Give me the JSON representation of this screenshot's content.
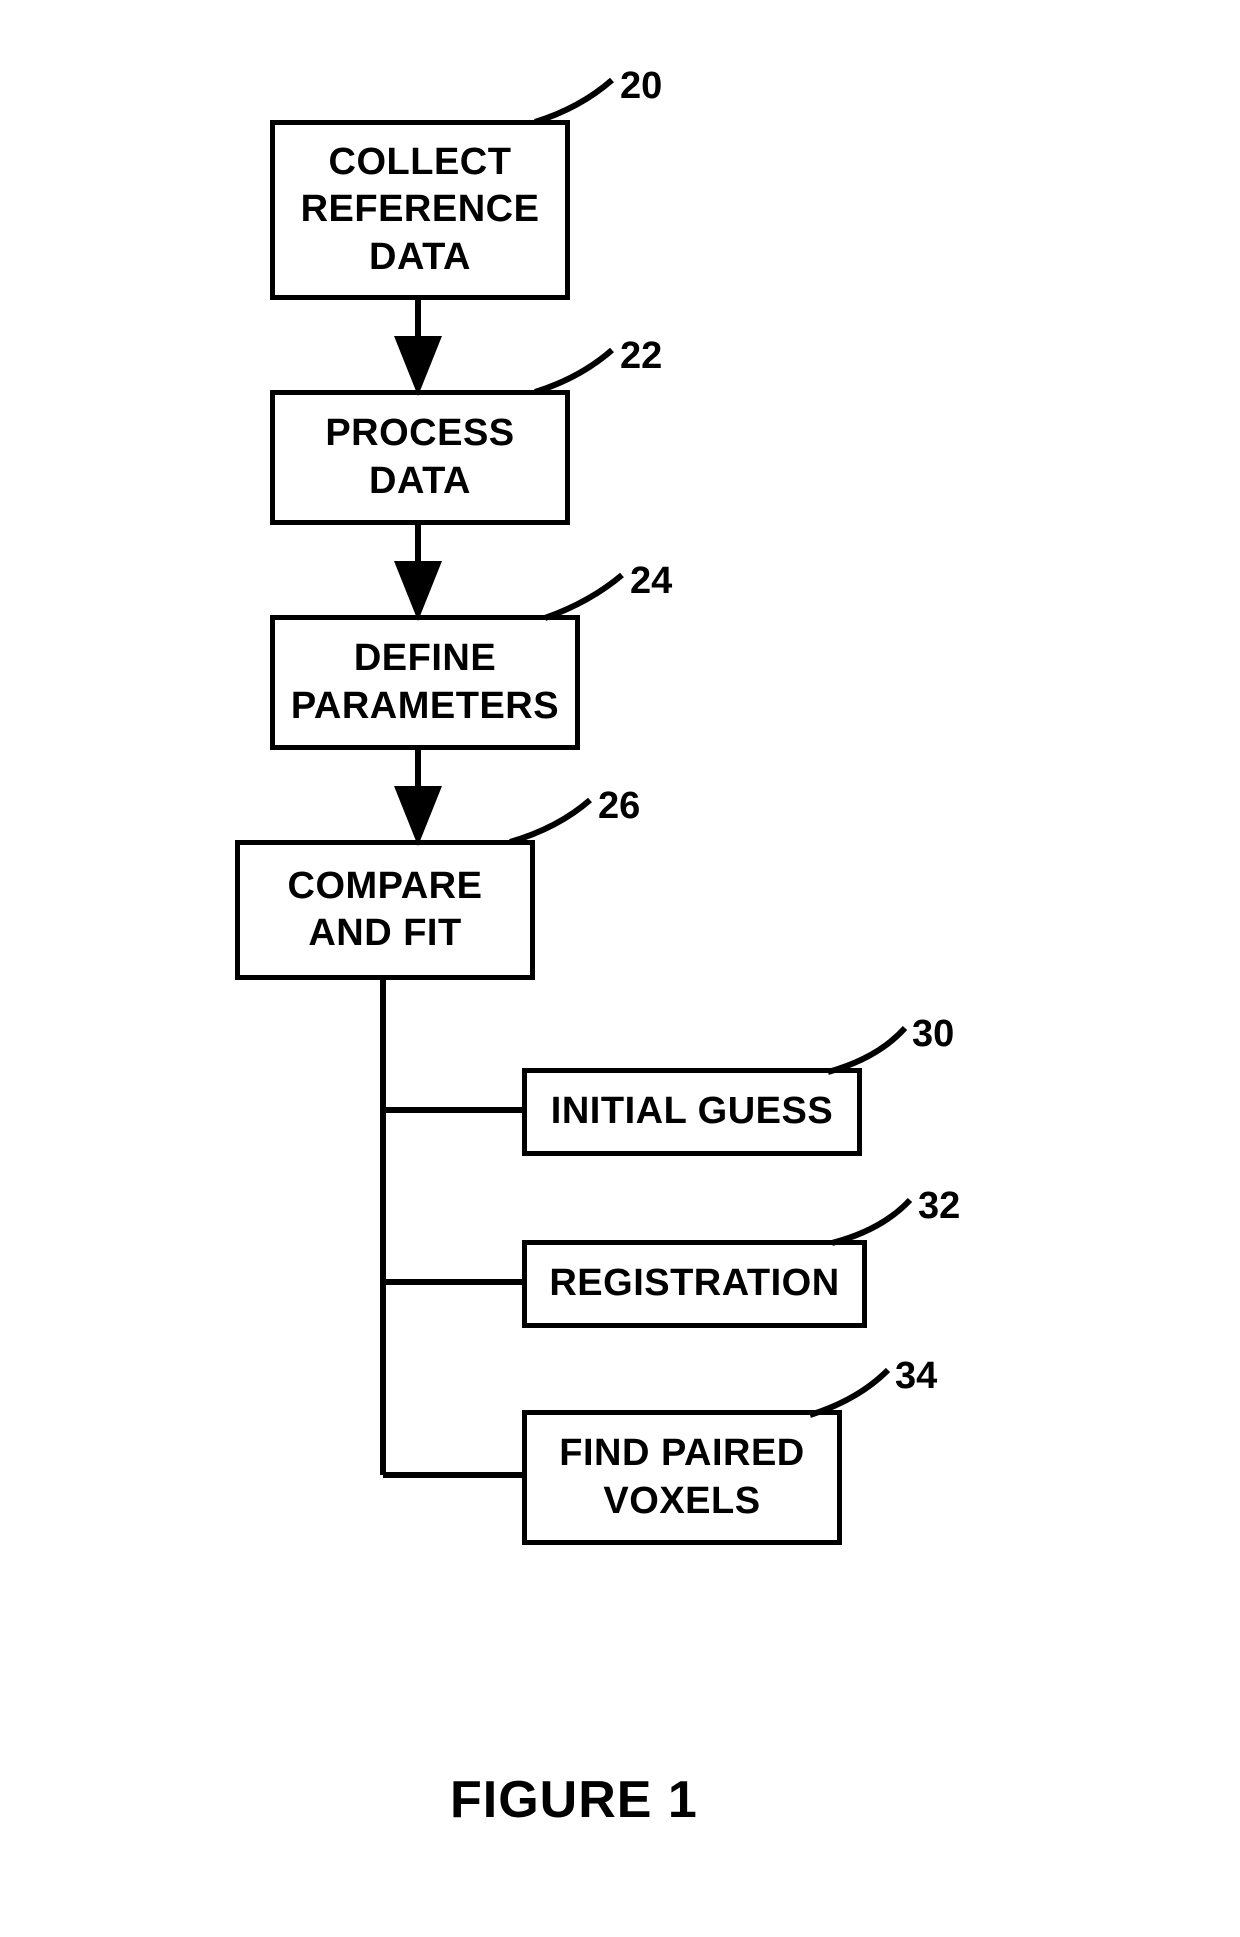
{
  "boxes": {
    "b20": {
      "line1": "COLLECT",
      "line2": "REFERENCE",
      "line3": "DATA"
    },
    "b22": {
      "line1": "PROCESS",
      "line2": "DATA"
    },
    "b24": {
      "line1": "DEFINE",
      "line2": "PARAMETERS"
    },
    "b26": {
      "line1": "COMPARE",
      "line2": "AND FIT"
    },
    "b30": {
      "line1": "INITIAL GUESS"
    },
    "b32": {
      "line1": "REGISTRATION"
    },
    "b34": {
      "line1": "FIND PAIRED",
      "line2": "VOXELS"
    }
  },
  "labels": {
    "l20": "20",
    "l22": "22",
    "l24": "24",
    "l26": "26",
    "l30": "30",
    "l32": "32",
    "l34": "34"
  },
  "title": "FIGURE 1"
}
